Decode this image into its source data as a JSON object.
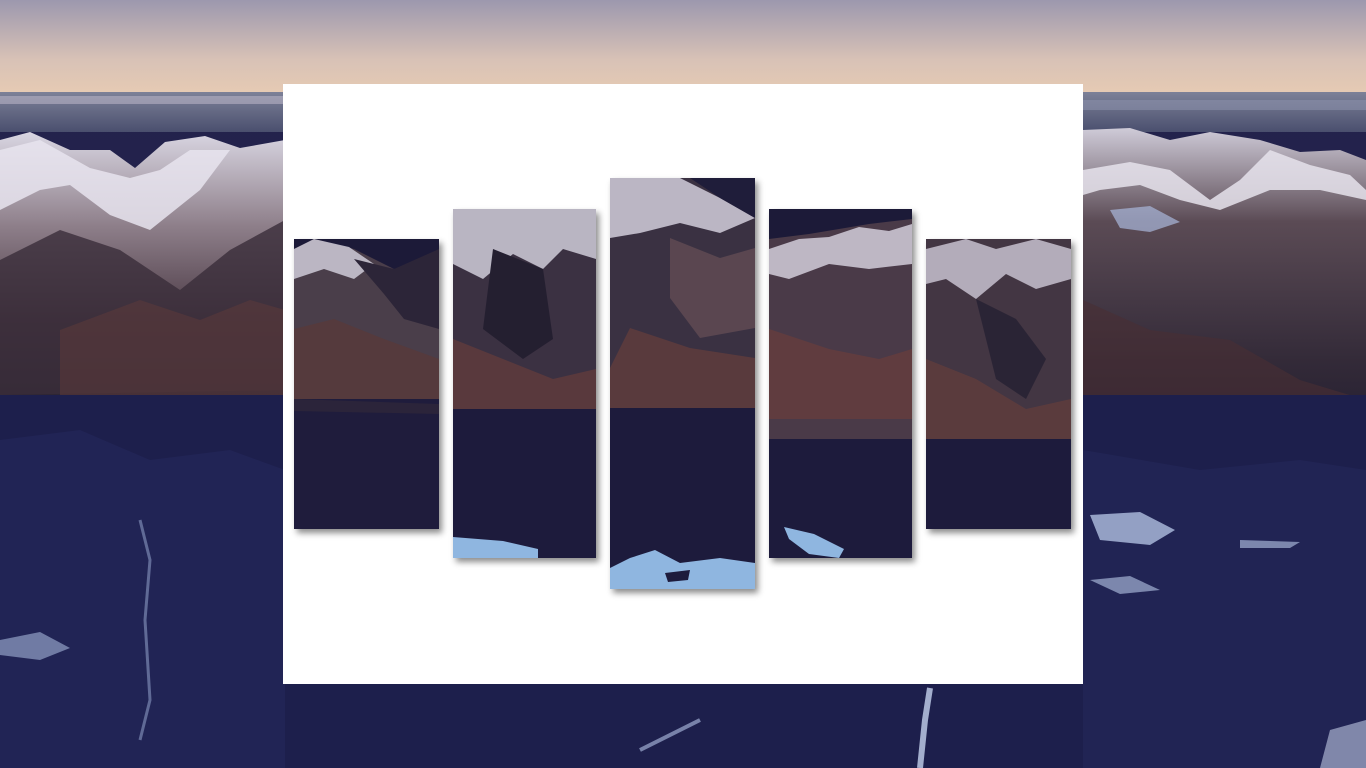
{
  "scene": {
    "background_photo": "aerial-snowy-mountain-range",
    "card_color": "#ffffff",
    "panel_count": 5
  },
  "palette": {
    "sky_top": "#9c98ae",
    "sky_horizon": "#e6cbb3",
    "snow": "#e8e6ee",
    "shadow_slope": "#2a2536",
    "warm_slope": "#6a3f3a",
    "valley": "#1b1c45",
    "lake_ice": "#6aa6d8"
  },
  "panels": [
    {
      "name": "panel-1"
    },
    {
      "name": "panel-2"
    },
    {
      "name": "panel-3"
    },
    {
      "name": "panel-4"
    },
    {
      "name": "panel-5"
    }
  ]
}
